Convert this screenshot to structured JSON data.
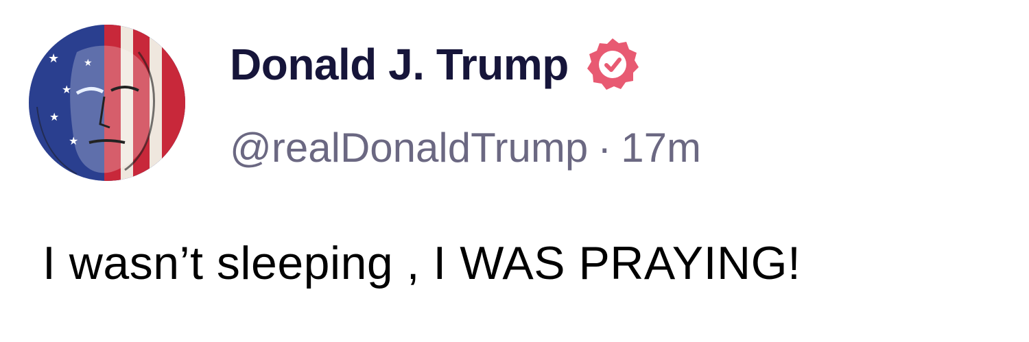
{
  "post": {
    "author": {
      "display_name": "Donald J. Trump",
      "handle": "@realDonaldTrump",
      "verified": true,
      "avatar": "portrait-with-american-flag-face-paint",
      "badge_icon": "verified-check-icon"
    },
    "separator": "·",
    "time_ago": "17m",
    "text": "I wasn’t sleeping , I WAS PRAYING!"
  },
  "colors": {
    "name": "#16153a",
    "meta": "#6b6882",
    "badge": "#e85a72",
    "body_text": "#000000",
    "flag_red": "#c8283a",
    "flag_blue": "#2a3f8f"
  }
}
